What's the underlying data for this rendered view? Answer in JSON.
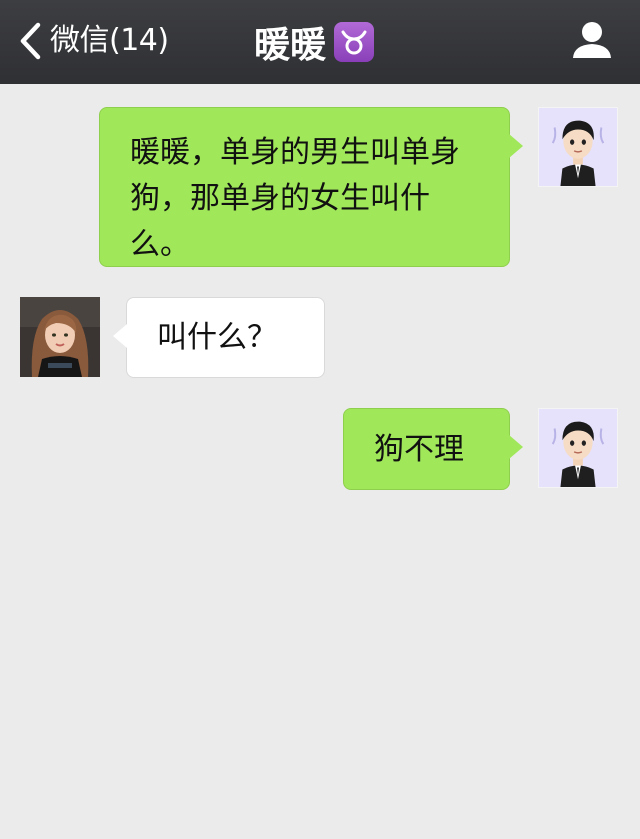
{
  "header": {
    "back_label": "微信(14)",
    "title": "暖暖",
    "title_badge_icon": "taurus-zodiac-icon",
    "title_badge_symbol": "♉",
    "profile_icon": "person-icon"
  },
  "colors": {
    "header_bg": "#333438",
    "chat_bg": "#ebebeb",
    "bubble_mine": "#a0e75a",
    "bubble_theirs": "#ffffff"
  },
  "messages": [
    {
      "sender": "me",
      "text": "暖暖，单身的男生叫单身狗，那单身的女生叫什么。"
    },
    {
      "sender": "her",
      "text": "叫什么？"
    },
    {
      "sender": "me",
      "text": "狗不理"
    }
  ]
}
